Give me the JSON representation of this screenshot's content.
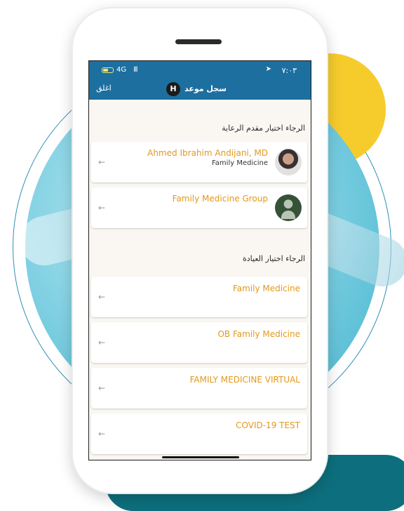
{
  "status_bar": {
    "network": "4G",
    "signal": "Ill",
    "time": "٧:٠٣"
  },
  "header": {
    "close_label": "اغلق",
    "avatar_initial": "H",
    "title": "سجل موعد"
  },
  "provider_section": {
    "title": "الرجاء اختيار مقدم الرعاية",
    "items": [
      {
        "name": "Ahmed Ibrahim Andijani, MD",
        "subtitle": "Family Medicine"
      },
      {
        "name": "Family Medicine Group"
      }
    ]
  },
  "clinic_section": {
    "title": "الرجاء اختيار العيادة",
    "items": [
      {
        "name": "Family Medicine"
      },
      {
        "name": "OB Family Medicine"
      },
      {
        "name": "FAMILY MEDICINE VIRTUAL"
      },
      {
        "name": "COVID-19 TEST"
      }
    ]
  },
  "icons": {
    "card_arrow": "arrow-left-icon",
    "status_location": "location-arrow-icon"
  },
  "colors": {
    "header_bg": "#1d6fa0",
    "accent_orange": "#e3981b",
    "yellow_circle": "#f6cc2c"
  },
  "arrow_glyph": "←"
}
